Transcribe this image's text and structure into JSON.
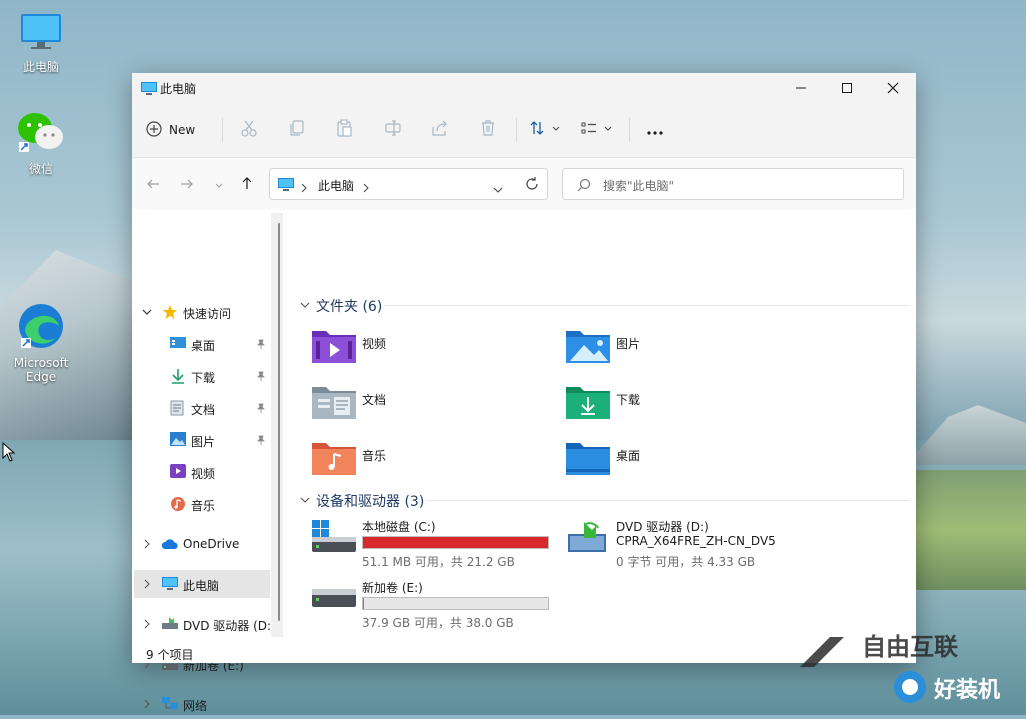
{
  "desktop": {
    "icons": [
      {
        "label": "此电脑",
        "icon": "monitor-icon"
      },
      {
        "label": "微信",
        "icon": "wechat-icon"
      },
      {
        "label": "Microsoft Edge",
        "icon": "edge-icon"
      }
    ]
  },
  "window": {
    "title": "此电脑",
    "controls": {
      "minimize": "minimize-icon",
      "maximize": "maximize-icon",
      "close": "close-icon"
    }
  },
  "toolbar": {
    "new_label": "New",
    "icons": [
      "cut-icon",
      "copy-icon",
      "paste-icon",
      "rename-icon",
      "share-icon",
      "delete-icon",
      "sort-icon",
      "view-icon",
      "more-icon"
    ]
  },
  "address_bar": {
    "path": "此电脑",
    "search_placeholder": "搜索\"此电脑\""
  },
  "nav_pane": {
    "quick_access": "快速访问",
    "quick_items": [
      {
        "label": "桌面",
        "icon": "desktop-icon",
        "pinned": true
      },
      {
        "label": "下载",
        "icon": "download-icon",
        "pinned": true
      },
      {
        "label": "文档",
        "icon": "document-icon",
        "pinned": true
      },
      {
        "label": "图片",
        "icon": "picture-icon",
        "pinned": true
      },
      {
        "label": "视频",
        "icon": "video-icon",
        "pinned": false
      },
      {
        "label": "音乐",
        "icon": "music-icon",
        "pinned": false
      }
    ],
    "roots": [
      {
        "label": "OneDrive",
        "icon": "cloud-icon"
      },
      {
        "label": "此电脑",
        "icon": "monitor-icon",
        "selected": true
      },
      {
        "label": "DVD 驱动器 (D:)",
        "icon": "dvd-icon"
      },
      {
        "label": "新加卷 (E:)",
        "icon": "drive-icon"
      },
      {
        "label": "网络",
        "icon": "network-icon"
      }
    ]
  },
  "content": {
    "folders_header": "文件夹 (6)",
    "folders": [
      {
        "label": "视频",
        "icon": "video-folder-icon"
      },
      {
        "label": "图片",
        "icon": "pictures-folder-icon"
      },
      {
        "label": "文档",
        "icon": "documents-folder-icon"
      },
      {
        "label": "下载",
        "icon": "downloads-folder-icon"
      },
      {
        "label": "音乐",
        "icon": "music-folder-icon"
      },
      {
        "label": "桌面",
        "icon": "desktop-folder-icon"
      }
    ],
    "drives_header": "设备和驱动器 (3)",
    "drives": [
      {
        "label": "本地磁盘 (C:)",
        "info": "51.1 MB 可用，共 21.2 GB",
        "used_fraction": 0.998,
        "bar_color": "#d9272e",
        "icon": "system-drive-icon"
      },
      {
        "label": "DVD 驱动器 (D:)",
        "label2": "CPRA_X64FRE_ZH-CN_DV5",
        "info": "0 字节 可用，共 4.33 GB",
        "icon": "dvd-install-icon"
      },
      {
        "label": "新加卷 (E:)",
        "info": "37.9 GB 可用，共 38.0 GB",
        "used_fraction": 0.003,
        "bar_color": "#26a0da",
        "icon": "drive-icon"
      }
    ]
  },
  "status_bar": {
    "item_count": "9 个项目"
  },
  "watermark": {
    "brand": "自由互联",
    "sub": "好装机"
  }
}
